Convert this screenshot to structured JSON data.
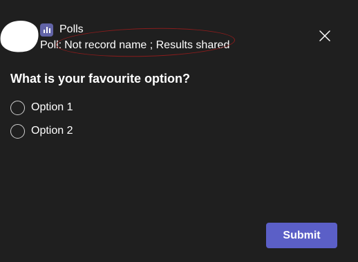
{
  "header": {
    "app_name": "Polls",
    "app_icon": "poll-chart-icon",
    "poll_prefix": "Poll:",
    "poll_settings": "Not record name ; Results shared",
    "close_icon": "close-icon"
  },
  "poll": {
    "question": "What is your favourite option?",
    "options": [
      {
        "label": "Option 1"
      },
      {
        "label": "Option 2"
      }
    ]
  },
  "actions": {
    "submit_label": "Submit"
  },
  "colors": {
    "background": "#1f1f1f",
    "accent": "#5b5fc7",
    "app_icon_bg": "#6264a7",
    "annotation_circle": "#8c1c1c"
  }
}
